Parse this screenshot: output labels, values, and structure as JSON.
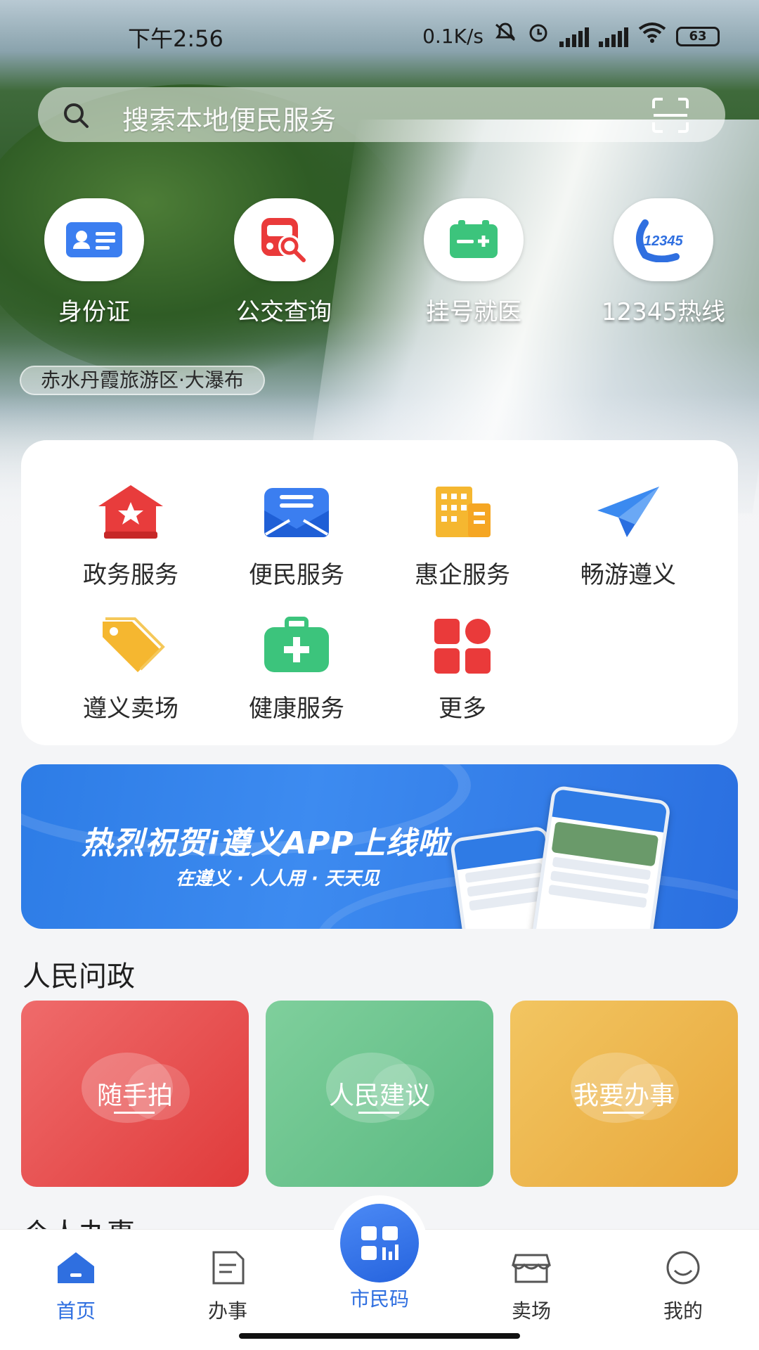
{
  "status_bar": {
    "time": "下午2:56",
    "net_speed": "0.1K/s",
    "battery": "63"
  },
  "search": {
    "placeholder": "搜索本地便民服务"
  },
  "quick_actions": [
    {
      "label": "身份证",
      "icon": "id-card-icon"
    },
    {
      "label": "公交查询",
      "icon": "bus-search-icon"
    },
    {
      "label": "挂号就医",
      "icon": "medical-card-icon"
    },
    {
      "label": "12345热线",
      "icon": "hotline-12345-icon"
    }
  ],
  "hotline_badge": "12345",
  "location_tag": "赤水丹霞旅游区·大瀑布",
  "services": [
    {
      "label": "政务服务",
      "icon": "government-icon"
    },
    {
      "label": "便民服务",
      "icon": "mail-icon"
    },
    {
      "label": "惠企服务",
      "icon": "building-icon"
    },
    {
      "label": "畅游遵义",
      "icon": "paper-plane-icon"
    },
    {
      "label": "遵义卖场",
      "icon": "price-tag-icon"
    },
    {
      "label": "健康服务",
      "icon": "medical-kit-icon"
    },
    {
      "label": "更多",
      "icon": "more-grid-icon"
    }
  ],
  "banner": {
    "title": "热烈祝贺i遵义APP上线啦",
    "subtitle": "在遵义 · 人人用 · 天天见"
  },
  "section_people": {
    "title": "人民问政",
    "cards": [
      {
        "label": "随手拍",
        "color": "#e84a4a"
      },
      {
        "label": "人民建议",
        "color": "#5fbf86"
      },
      {
        "label": "我要办事",
        "color": "#ebb24a"
      }
    ]
  },
  "section_personal": {
    "title": "个人办事"
  },
  "bottom_nav": {
    "items": [
      {
        "label": "首页",
        "icon": "home-icon",
        "active": true
      },
      {
        "label": "办事",
        "icon": "document-icon",
        "active": false
      },
      {
        "label": "市民码",
        "icon": "citizen-code-icon",
        "active": false
      },
      {
        "label": "卖场",
        "icon": "store-icon",
        "active": false
      },
      {
        "label": "我的",
        "icon": "profile-icon",
        "active": false
      }
    ]
  },
  "colors": {
    "accent": "#2f6fe0",
    "banner": "#3d8bf0",
    "red": "#e84a4a",
    "green": "#5fbf86",
    "amber": "#ebb24a"
  }
}
